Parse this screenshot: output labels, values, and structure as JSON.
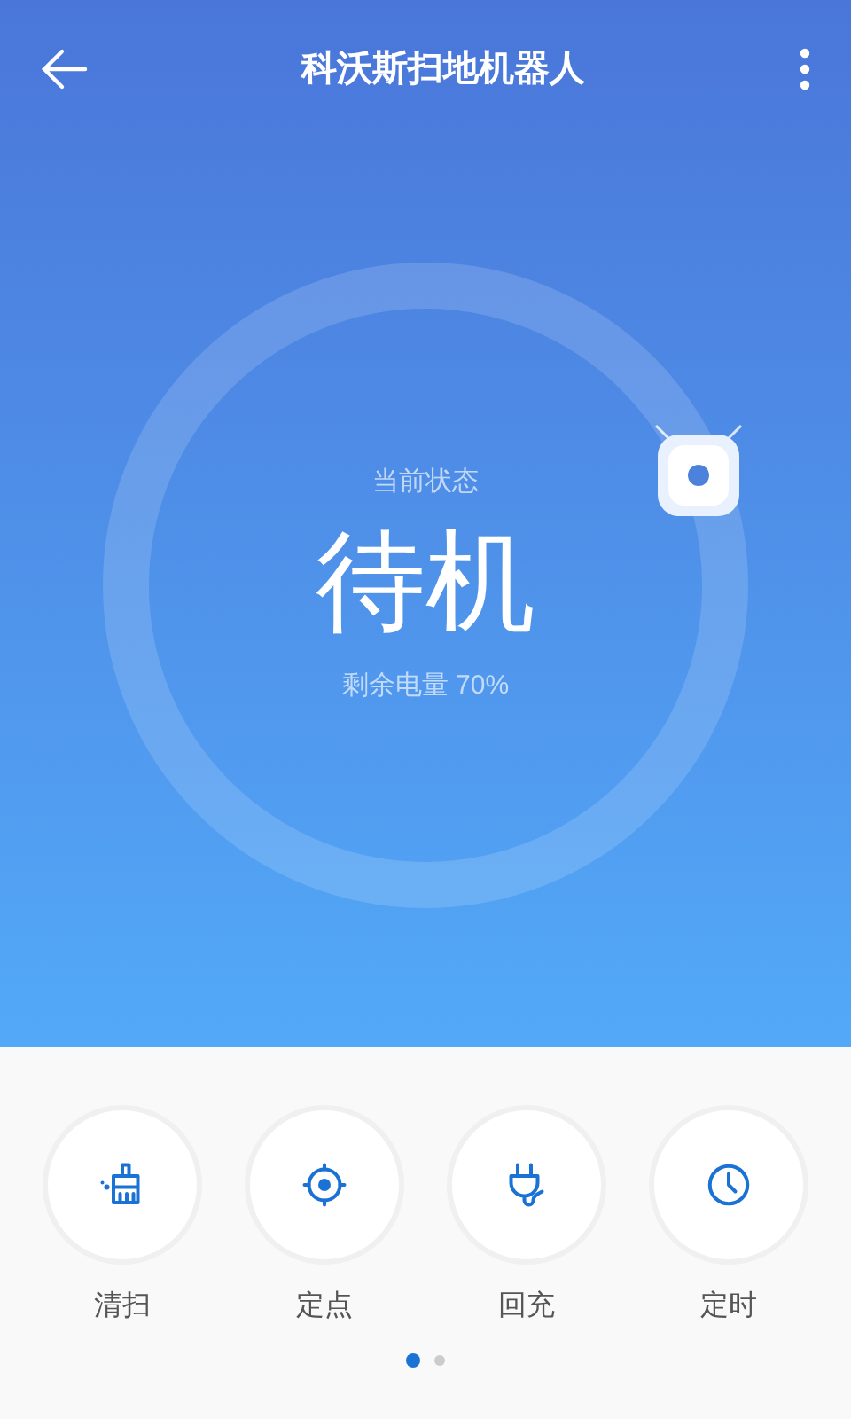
{
  "header": {
    "title": "科沃斯扫地机器人"
  },
  "status": {
    "label": "当前状态",
    "value": "待机",
    "battery": "剩余电量 70%"
  },
  "actions": [
    {
      "kind": "clean",
      "label": "清扫"
    },
    {
      "kind": "spot",
      "label": "定点"
    },
    {
      "kind": "charge",
      "label": "回充"
    },
    {
      "kind": "timer",
      "label": "定时"
    }
  ],
  "pages": [
    {
      "selected": true
    },
    {
      "selected": false
    }
  ]
}
